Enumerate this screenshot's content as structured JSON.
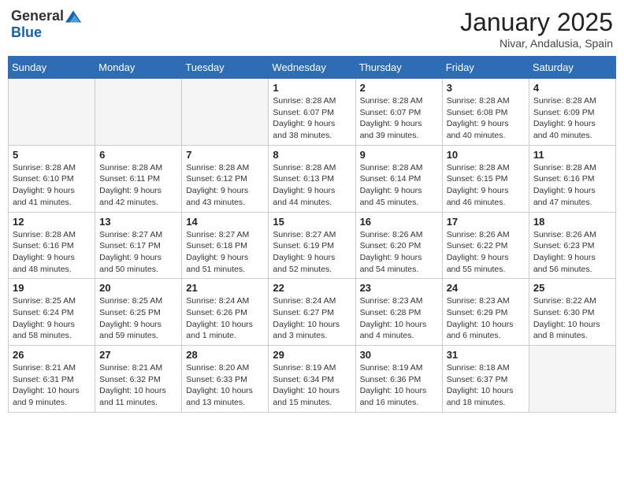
{
  "header": {
    "logo_general": "General",
    "logo_blue": "Blue",
    "month": "January 2025",
    "location": "Nivar, Andalusia, Spain"
  },
  "days_of_week": [
    "Sunday",
    "Monday",
    "Tuesday",
    "Wednesday",
    "Thursday",
    "Friday",
    "Saturday"
  ],
  "weeks": [
    [
      {
        "day": "",
        "info": ""
      },
      {
        "day": "",
        "info": ""
      },
      {
        "day": "",
        "info": ""
      },
      {
        "day": "1",
        "info": "Sunrise: 8:28 AM\nSunset: 6:07 PM\nDaylight: 9 hours and 38 minutes."
      },
      {
        "day": "2",
        "info": "Sunrise: 8:28 AM\nSunset: 6:07 PM\nDaylight: 9 hours and 39 minutes."
      },
      {
        "day": "3",
        "info": "Sunrise: 8:28 AM\nSunset: 6:08 PM\nDaylight: 9 hours and 40 minutes."
      },
      {
        "day": "4",
        "info": "Sunrise: 8:28 AM\nSunset: 6:09 PM\nDaylight: 9 hours and 40 minutes."
      }
    ],
    [
      {
        "day": "5",
        "info": "Sunrise: 8:28 AM\nSunset: 6:10 PM\nDaylight: 9 hours and 41 minutes."
      },
      {
        "day": "6",
        "info": "Sunrise: 8:28 AM\nSunset: 6:11 PM\nDaylight: 9 hours and 42 minutes."
      },
      {
        "day": "7",
        "info": "Sunrise: 8:28 AM\nSunset: 6:12 PM\nDaylight: 9 hours and 43 minutes."
      },
      {
        "day": "8",
        "info": "Sunrise: 8:28 AM\nSunset: 6:13 PM\nDaylight: 9 hours and 44 minutes."
      },
      {
        "day": "9",
        "info": "Sunrise: 8:28 AM\nSunset: 6:14 PM\nDaylight: 9 hours and 45 minutes."
      },
      {
        "day": "10",
        "info": "Sunrise: 8:28 AM\nSunset: 6:15 PM\nDaylight: 9 hours and 46 minutes."
      },
      {
        "day": "11",
        "info": "Sunrise: 8:28 AM\nSunset: 6:16 PM\nDaylight: 9 hours and 47 minutes."
      }
    ],
    [
      {
        "day": "12",
        "info": "Sunrise: 8:28 AM\nSunset: 6:16 PM\nDaylight: 9 hours and 48 minutes."
      },
      {
        "day": "13",
        "info": "Sunrise: 8:27 AM\nSunset: 6:17 PM\nDaylight: 9 hours and 50 minutes."
      },
      {
        "day": "14",
        "info": "Sunrise: 8:27 AM\nSunset: 6:18 PM\nDaylight: 9 hours and 51 minutes."
      },
      {
        "day": "15",
        "info": "Sunrise: 8:27 AM\nSunset: 6:19 PM\nDaylight: 9 hours and 52 minutes."
      },
      {
        "day": "16",
        "info": "Sunrise: 8:26 AM\nSunset: 6:20 PM\nDaylight: 9 hours and 54 minutes."
      },
      {
        "day": "17",
        "info": "Sunrise: 8:26 AM\nSunset: 6:22 PM\nDaylight: 9 hours and 55 minutes."
      },
      {
        "day": "18",
        "info": "Sunrise: 8:26 AM\nSunset: 6:23 PM\nDaylight: 9 hours and 56 minutes."
      }
    ],
    [
      {
        "day": "19",
        "info": "Sunrise: 8:25 AM\nSunset: 6:24 PM\nDaylight: 9 hours and 58 minutes."
      },
      {
        "day": "20",
        "info": "Sunrise: 8:25 AM\nSunset: 6:25 PM\nDaylight: 9 hours and 59 minutes."
      },
      {
        "day": "21",
        "info": "Sunrise: 8:24 AM\nSunset: 6:26 PM\nDaylight: 10 hours and 1 minute."
      },
      {
        "day": "22",
        "info": "Sunrise: 8:24 AM\nSunset: 6:27 PM\nDaylight: 10 hours and 3 minutes."
      },
      {
        "day": "23",
        "info": "Sunrise: 8:23 AM\nSunset: 6:28 PM\nDaylight: 10 hours and 4 minutes."
      },
      {
        "day": "24",
        "info": "Sunrise: 8:23 AM\nSunset: 6:29 PM\nDaylight: 10 hours and 6 minutes."
      },
      {
        "day": "25",
        "info": "Sunrise: 8:22 AM\nSunset: 6:30 PM\nDaylight: 10 hours and 8 minutes."
      }
    ],
    [
      {
        "day": "26",
        "info": "Sunrise: 8:21 AM\nSunset: 6:31 PM\nDaylight: 10 hours and 9 minutes."
      },
      {
        "day": "27",
        "info": "Sunrise: 8:21 AM\nSunset: 6:32 PM\nDaylight: 10 hours and 11 minutes."
      },
      {
        "day": "28",
        "info": "Sunrise: 8:20 AM\nSunset: 6:33 PM\nDaylight: 10 hours and 13 minutes."
      },
      {
        "day": "29",
        "info": "Sunrise: 8:19 AM\nSunset: 6:34 PM\nDaylight: 10 hours and 15 minutes."
      },
      {
        "day": "30",
        "info": "Sunrise: 8:19 AM\nSunset: 6:36 PM\nDaylight: 10 hours and 16 minutes."
      },
      {
        "day": "31",
        "info": "Sunrise: 8:18 AM\nSunset: 6:37 PM\nDaylight: 10 hours and 18 minutes."
      },
      {
        "day": "",
        "info": ""
      }
    ]
  ]
}
